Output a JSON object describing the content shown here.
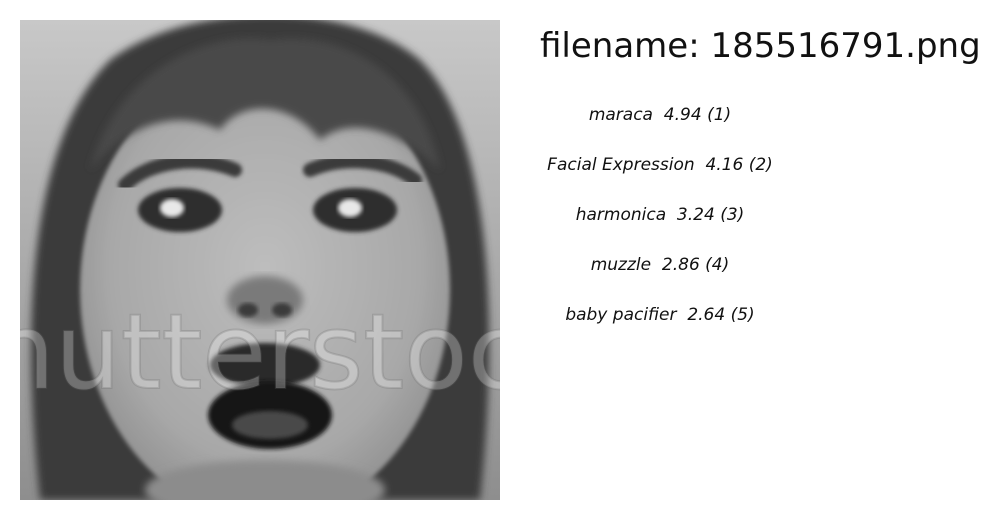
{
  "filename": {
    "label": "filename:",
    "value": "185516791.png"
  },
  "image": {
    "subject": "grayscale face with open mouth",
    "watermark_text": "shutterstock"
  },
  "predictions": [
    {
      "label": "maraca",
      "score": "4.94",
      "rank": "(1)"
    },
    {
      "label": "Facial Expression",
      "score": "4.16",
      "rank": "(2)"
    },
    {
      "label": "harmonica",
      "score": "3.24",
      "rank": "(3)"
    },
    {
      "label": "muzzle",
      "score": "2.86",
      "rank": "(4)"
    },
    {
      "label": "baby pacifier",
      "score": "2.64",
      "rank": "(5)"
    }
  ]
}
